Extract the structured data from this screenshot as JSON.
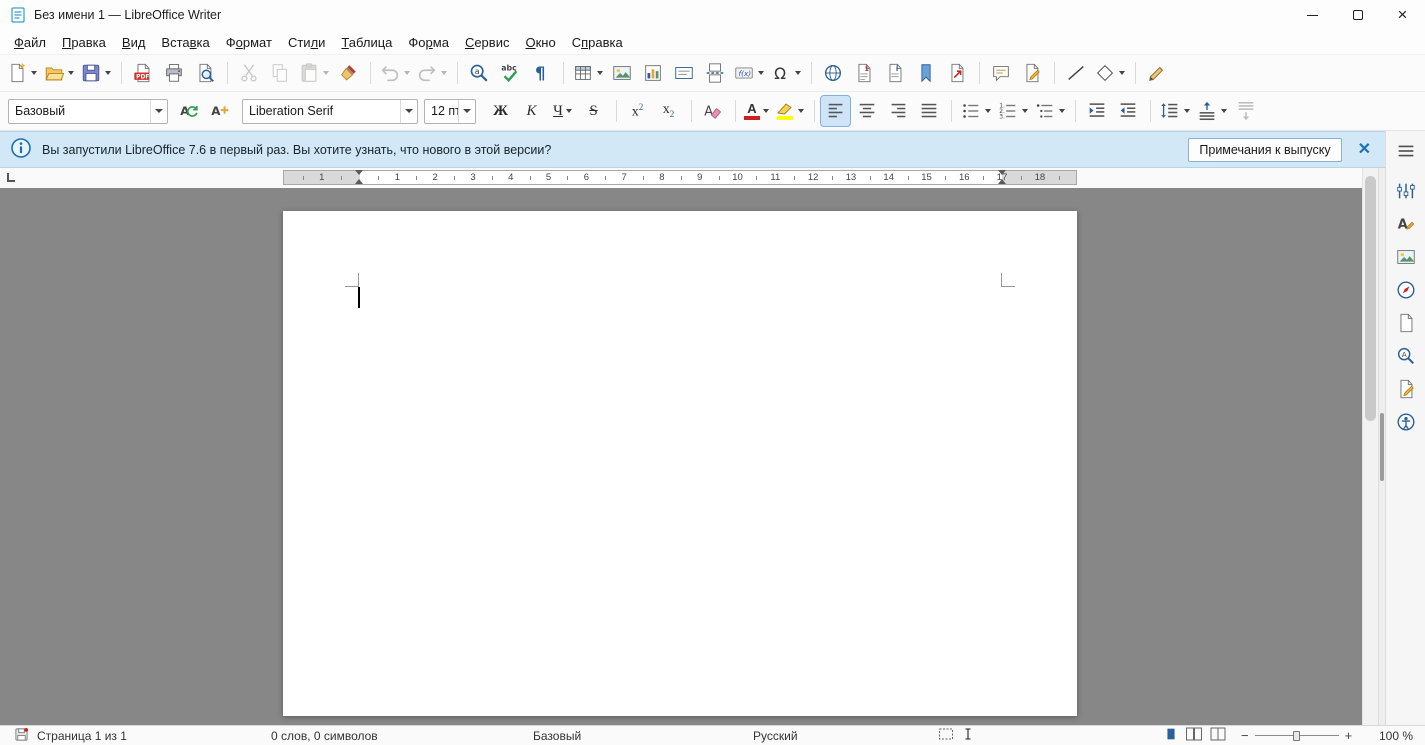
{
  "window": {
    "title": "Без имени 1 — LibreOffice Writer"
  },
  "colors": {
    "accent_blue": "#2a6099",
    "infobar_bg": "#d2e8f6",
    "canvas_bg": "#878787",
    "font_color_red": "#c9211e",
    "highlight_yellow": "#ffff00"
  },
  "menubar": {
    "items": [
      {
        "name": "file",
        "label": "Файл",
        "accel": 0
      },
      {
        "name": "edit",
        "label": "Правка",
        "accel": 0
      },
      {
        "name": "view",
        "label": "Вид",
        "accel": 0
      },
      {
        "name": "insert",
        "label": "Вставка",
        "accel": 4
      },
      {
        "name": "format",
        "label": "Формат",
        "accel": 1
      },
      {
        "name": "styles",
        "label": "Стили",
        "accel": 3
      },
      {
        "name": "table",
        "label": "Таблица",
        "accel": 0
      },
      {
        "name": "form",
        "label": "Форма",
        "accel": 2
      },
      {
        "name": "tools",
        "label": "Сервис",
        "accel": 0
      },
      {
        "name": "window",
        "label": "Окно",
        "accel": 0
      },
      {
        "name": "help",
        "label": "Справка",
        "accel": 1
      }
    ]
  },
  "standard_toolbar": {
    "items": [
      {
        "name": "new-document",
        "dropdown": true
      },
      {
        "name": "open",
        "dropdown": true
      },
      {
        "name": "save",
        "dropdown": true
      },
      {
        "sep": true
      },
      {
        "name": "export-pdf"
      },
      {
        "name": "print"
      },
      {
        "name": "print-preview"
      },
      {
        "sep": true
      },
      {
        "name": "cut",
        "disabled": true
      },
      {
        "name": "copy",
        "disabled": true
      },
      {
        "name": "paste",
        "dropdown": true,
        "disabled": true
      },
      {
        "name": "clone-formatting"
      },
      {
        "sep": true
      },
      {
        "name": "undo",
        "dropdown": true,
        "disabled": true
      },
      {
        "name": "redo",
        "dropdown": true,
        "disabled": true
      },
      {
        "sep": true
      },
      {
        "name": "find-replace"
      },
      {
        "name": "spelling"
      },
      {
        "name": "formatting-marks"
      },
      {
        "sep": true
      },
      {
        "name": "insert-table",
        "dropdown": true
      },
      {
        "name": "insert-image"
      },
      {
        "name": "insert-chart"
      },
      {
        "name": "insert-text-box"
      },
      {
        "name": "insert-page-break"
      },
      {
        "name": "insert-field",
        "dropdown": true
      },
      {
        "name": "insert-special-character",
        "dropdown": true
      },
      {
        "sep": true
      },
      {
        "name": "insert-hyperlink"
      },
      {
        "name": "insert-footnote"
      },
      {
        "name": "insert-endnote"
      },
      {
        "name": "insert-bookmark"
      },
      {
        "name": "insert-cross-reference"
      },
      {
        "sep": true
      },
      {
        "name": "insert-comment"
      },
      {
        "name": "track-changes"
      },
      {
        "sep": true
      },
      {
        "name": "insert-line"
      },
      {
        "name": "basic-shapes",
        "dropdown": true
      },
      {
        "sep": true
      },
      {
        "name": "draw-functions"
      }
    ]
  },
  "formatting_toolbar": {
    "paragraph_style": "Базовый",
    "font_name": "Liberation Serif",
    "font_size": "12 пт",
    "style_actions": [
      {
        "name": "update-style"
      },
      {
        "name": "new-style"
      }
    ],
    "items": [
      {
        "name": "bold",
        "label": "Ж",
        "style": "bold"
      },
      {
        "name": "italic",
        "label": "К",
        "style": "italic"
      },
      {
        "name": "underline",
        "label": "Ч",
        "style": "underline",
        "dropdown": true
      },
      {
        "name": "strikethrough",
        "label": "S",
        "style": "strike"
      },
      {
        "sep": true
      },
      {
        "name": "superscript"
      },
      {
        "name": "subscript"
      },
      {
        "sep": true
      },
      {
        "name": "clear-formatting"
      },
      {
        "sep": true
      },
      {
        "name": "font-color",
        "dropdown": true
      },
      {
        "name": "highlight-color",
        "dropdown": true
      },
      {
        "sep": true
      },
      {
        "name": "align-left",
        "active": true
      },
      {
        "name": "align-center"
      },
      {
        "name": "align-right"
      },
      {
        "name": "align-justify"
      },
      {
        "sep": true
      },
      {
        "name": "list-bullet",
        "dropdown": true
      },
      {
        "name": "list-number",
        "dropdown": true
      },
      {
        "name": "list-outline",
        "dropdown": true
      },
      {
        "sep": true
      },
      {
        "name": "indent-increase"
      },
      {
        "name": "indent-decrease"
      },
      {
        "sep": true
      },
      {
        "name": "line-spacing",
        "dropdown": true
      },
      {
        "name": "paragraph-spacing-increase",
        "dropdown": true
      },
      {
        "name": "paragraph-spacing-decrease",
        "disabled": true
      }
    ]
  },
  "infobar": {
    "message": "Вы запустили LibreOffice 7.6 в первый раз. Вы хотите узнать, что нового в этой версии?",
    "button_label": "Примечания к выпуску"
  },
  "ruler": {
    "left_margin_number": "1",
    "numbers": [
      "1",
      "2",
      "3",
      "4",
      "5",
      "6",
      "7",
      "8",
      "9",
      "10",
      "11",
      "12",
      "13",
      "14",
      "15",
      "16",
      "17",
      "18"
    ]
  },
  "sidebar": {
    "items": [
      {
        "name": "sidebar-settings"
      },
      {
        "name": "properties"
      },
      {
        "name": "styles"
      },
      {
        "name": "gallery"
      },
      {
        "name": "navigator"
      },
      {
        "name": "page"
      },
      {
        "name": "style-inspector"
      },
      {
        "name": "manage-changes"
      },
      {
        "name": "accessibility-check"
      }
    ]
  },
  "statusbar": {
    "page": "Страница 1 из 1",
    "word_count": "0 слов, 0 символов",
    "page_style": "Базовый",
    "language": "Русский",
    "zoom_value": "100 %"
  }
}
